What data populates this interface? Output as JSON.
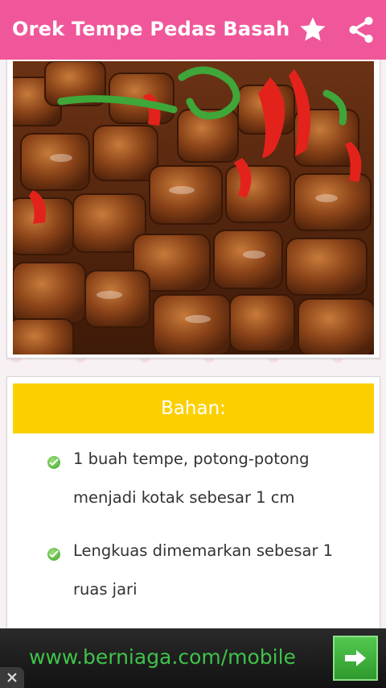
{
  "appbar": {
    "title": "Orek Tempe Pedas Basah",
    "actions": [
      {
        "icon": "star-icon"
      },
      {
        "icon": "share-icon"
      }
    ]
  },
  "colors": {
    "appbar": "#f0579a",
    "header_bar": "#fcd000",
    "ad_text": "#3fc24a"
  },
  "ingredients": {
    "header": "Bahan:",
    "items": [
      {
        "text": "1 buah tempe, potong-potong menjadi kotak sebesar 1 cm"
      },
      {
        "text": "Lengkuas dimemarkan sebesar 1 ruas jari"
      }
    ]
  },
  "ad": {
    "text": "www.berniaga.com/mobile"
  }
}
